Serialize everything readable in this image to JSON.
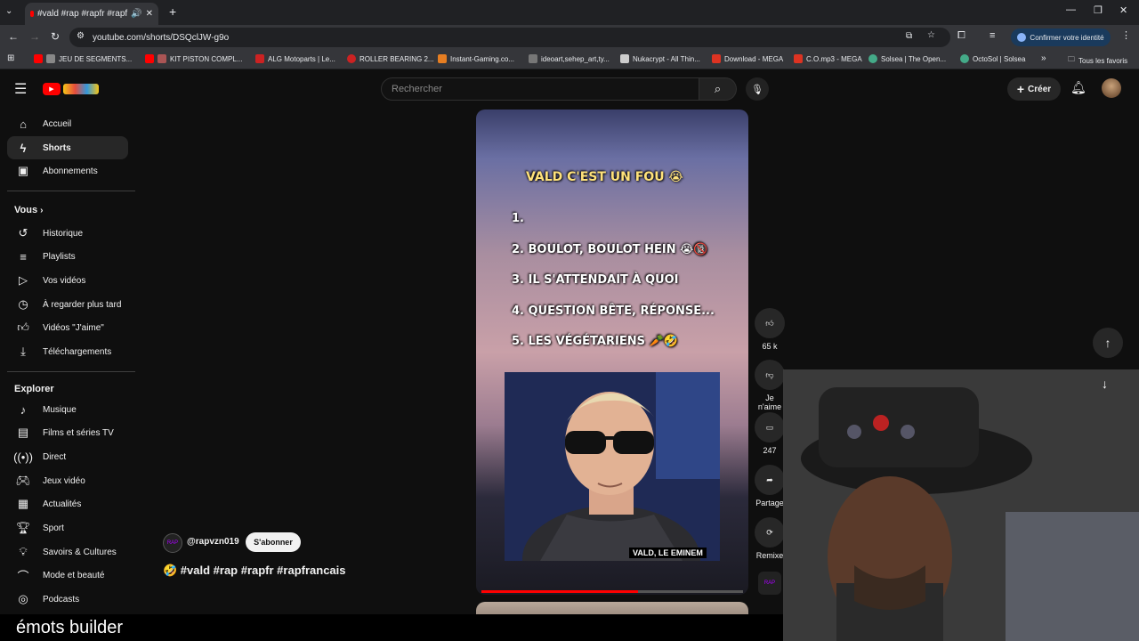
{
  "browser": {
    "tab_title": "#vald #rap #rapfr #rapf",
    "url": "youtube.com/shorts/DSQclJW-g9o",
    "identity_button": "Confirmer votre identité",
    "bookmarks": [
      "JEU DE SEGMENTS...",
      "KIT PISTON COMPL...",
      "ALG Motoparts | Le...",
      "ROLLER BEARING 2...",
      "Instant-Gaming.co...",
      "ideoart,sehep_art,ty...",
      "Nukacrypt - All Thin...",
      "Download - MEGA",
      "C.O.mp3 - MEGA",
      "Solsea | The Open...",
      "OctoSol | Solsea"
    ],
    "all_favorites": "Tous les favoris"
  },
  "youtube": {
    "search_placeholder": "Rechercher",
    "create_label": "Créer",
    "nav_main": [
      "Accueil",
      "Shorts",
      "Abonnements"
    ],
    "you_title": "Vous",
    "nav_you": [
      "Historique",
      "Playlists",
      "Vos vidéos",
      "À regarder plus tard",
      "Vidéos \"J'aime\"",
      "Téléchargements"
    ],
    "explore_title": "Explorer",
    "nav_explore": [
      "Musique",
      "Films et séries TV",
      "Direct",
      "Jeux vidéo",
      "Actualités",
      "Sport",
      "Savoirs & Cultures",
      "Mode et beauté",
      "Podcasts"
    ]
  },
  "short": {
    "title_line": "VALD C'EST UN FOU 😭",
    "items": [
      "1.",
      "2. BOULOT, BOULOT HEIN 😭🔞",
      "3. IL S'ATTENDAIT À QUOI",
      "4. QUESTION BÊTE, RÉPONSE...",
      "5. LES VÉGÉTARIENS 🥕🤣"
    ],
    "caption": "VALD, LE EMINEM",
    "channel": "@rapvzn019",
    "subscribe": "S'abonner",
    "hashtags": "🤣 #vald #rap #rapfr #rapfrancais",
    "progress": 0.6
  },
  "actions": {
    "likes": "65 k",
    "dislike": "Je n'aime",
    "comments": "247",
    "share": "Partage",
    "remix": "Remixe"
  },
  "overlay": {
    "text": "émots builder"
  }
}
